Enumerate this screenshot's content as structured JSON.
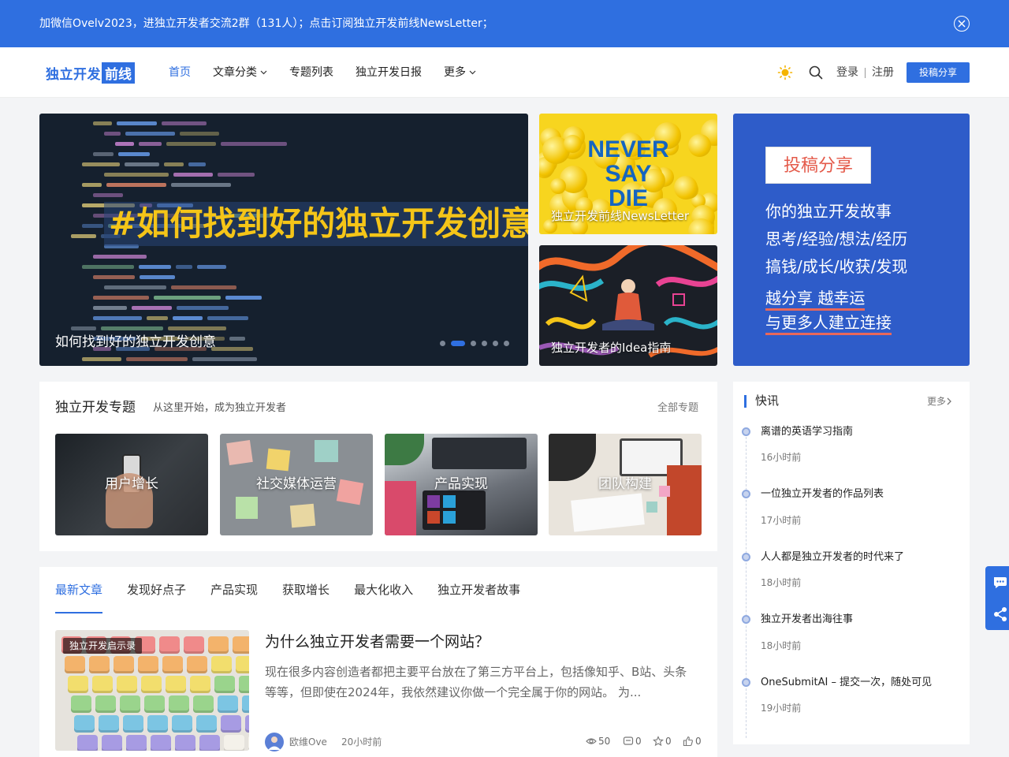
{
  "banner": {
    "text": "加微信Ovelv2023，进独立开发者交流2群（131人）；点击订阅独立开发前线NewsLetter；"
  },
  "header": {
    "logo_a": "独立开发",
    "logo_b": "前线",
    "nav": [
      "首页",
      "文章分类",
      "专题列表",
      "独立开发日报",
      "更多"
    ],
    "login": "登录",
    "register": "注册",
    "submit": "投稿分享"
  },
  "hero": {
    "headline": "#如何找到好的独立开发创意",
    "caption": "如何找到好的独立开发创意",
    "slide_count": 6,
    "active_slide": 1
  },
  "side_cards": [
    {
      "image_text": [
        "NEVER",
        "SAY",
        "DIE"
      ],
      "caption": "独立开发前线NewsLetter"
    },
    {
      "caption": "独立开发者的Idea指南"
    }
  ],
  "promo": {
    "button": "投稿分享",
    "lines": [
      "你的独立开发故事",
      "思考/经验/想法/经历",
      "搞钱/成长/收获/发现"
    ],
    "underlined": [
      "越分享 越幸运",
      "与更多人建立连接"
    ]
  },
  "topics": {
    "title": "独立开发专题",
    "subtitle": "从这里开始，成为独立开发者",
    "all": "全部专题",
    "items": [
      "用户增长",
      "社交媒体运营",
      "产品实现",
      "团队构建"
    ]
  },
  "articles": {
    "tabs": [
      "最新文章",
      "发现好点子",
      "产品实现",
      "获取增长",
      "最大化收入",
      "独立开发者故事"
    ],
    "item": {
      "tag": "独立开发启示录",
      "title": "为什么独立开发者需要一个网站？",
      "excerpt": "现在很多内容创造者都把主要平台放在了第三方平台上，包括像知乎、B站、头条等等，但即使在2024年，我依然建议你做一个完全属于你的网站。 为...",
      "author": "欧维Ove",
      "time": "20小时前",
      "views": "50",
      "comments": "0",
      "favorites": "0",
      "likes": "0"
    }
  },
  "news": {
    "title": "快讯",
    "more": "更多",
    "items": [
      {
        "title": "离谱的英语学习指南",
        "time": "16小时前"
      },
      {
        "title": "一位独立开发者的作品列表",
        "time": "17小时前"
      },
      {
        "title": "人人都是独立开发者的时代来了",
        "time": "18小时前"
      },
      {
        "title": "独立开发者出海往事",
        "time": "18小时前"
      },
      {
        "title": "OneSubmitAI – 提交一次，随处可见",
        "time": "19小时前"
      }
    ]
  },
  "icons": [
    "close-icon",
    "chevron-down-icon",
    "sun-icon",
    "search-icon",
    "eye-icon",
    "comment-icon",
    "star-icon",
    "thumbs-up-icon",
    "chevron-right-icon",
    "chat-icon",
    "share-icon"
  ],
  "colors": {
    "brand": "#2f6fe0",
    "promo_bg": "#2e5cc9",
    "headline": "#f5c518",
    "promo_accent": "#e8685a"
  }
}
